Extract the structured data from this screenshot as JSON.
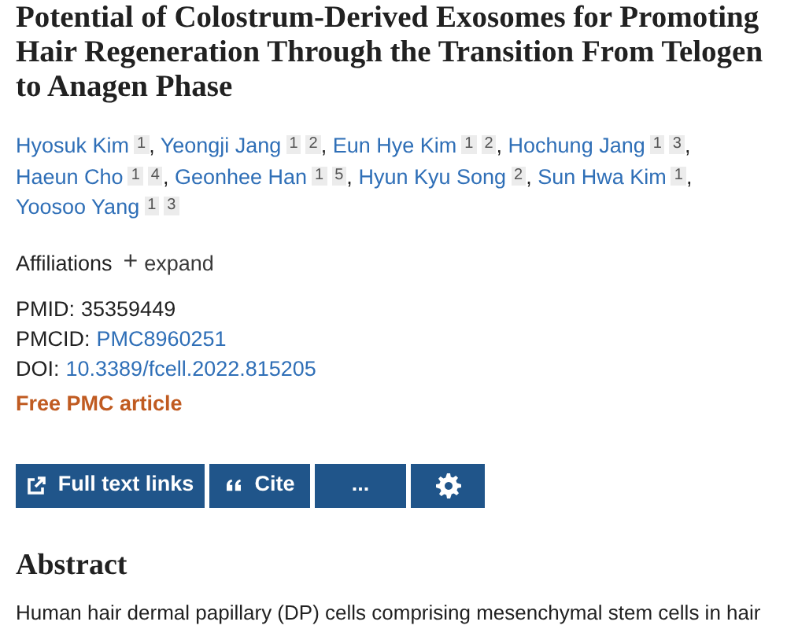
{
  "title": "Potential of Colostrum-Derived Exosomes for Promoting Hair Regeneration Through the Transition From Telogen to Anagen Phase",
  "authors": [
    {
      "name": "Hyosuk Kim",
      "affiliations": [
        "1"
      ],
      "separator": ","
    },
    {
      "name": "Yeongji Jang",
      "affiliations": [
        "1",
        "2"
      ],
      "separator": ","
    },
    {
      "name": "Eun Hye Kim",
      "affiliations": [
        "1",
        "2"
      ],
      "separator": ","
    },
    {
      "name": "Hochung Jang",
      "affiliations": [
        "1",
        "3"
      ],
      "separator": ","
    },
    {
      "name": "Haeun Cho",
      "affiliations": [
        "1",
        "4"
      ],
      "separator": ","
    },
    {
      "name": "Geonhee Han",
      "affiliations": [
        "1",
        "5"
      ],
      "separator": ","
    },
    {
      "name": "Hyun Kyu Song",
      "affiliations": [
        "2"
      ],
      "separator": ","
    },
    {
      "name": "Sun Hwa Kim",
      "affiliations": [
        "1"
      ],
      "separator": ","
    },
    {
      "name": "Yoosoo Yang",
      "affiliations": [
        "1",
        "3"
      ]
    }
  ],
  "affiliations": {
    "label": "Affiliations",
    "toggle_icon": "+",
    "toggle": "expand"
  },
  "identifiers": [
    {
      "label": "PMID:",
      "value": "35359449",
      "kind": "plain"
    },
    {
      "label": "PMCID:",
      "value": "PMC8960251",
      "kind": "link"
    },
    {
      "label": "DOI:",
      "value": "10.3389/fcell.2022.815205",
      "kind": "link"
    }
  ],
  "free_pmc": "Free PMC article",
  "actions": [
    {
      "kind": "external",
      "label": "Full text links"
    },
    {
      "kind": "quote",
      "label": "Cite"
    },
    {
      "kind": "more",
      "label": "..."
    },
    {
      "kind": "gear"
    }
  ],
  "abstract": {
    "heading": "Abstract",
    "text": "Human hair dermal papillary (DP) cells comprising mesenchymal stem cells in hair"
  }
}
